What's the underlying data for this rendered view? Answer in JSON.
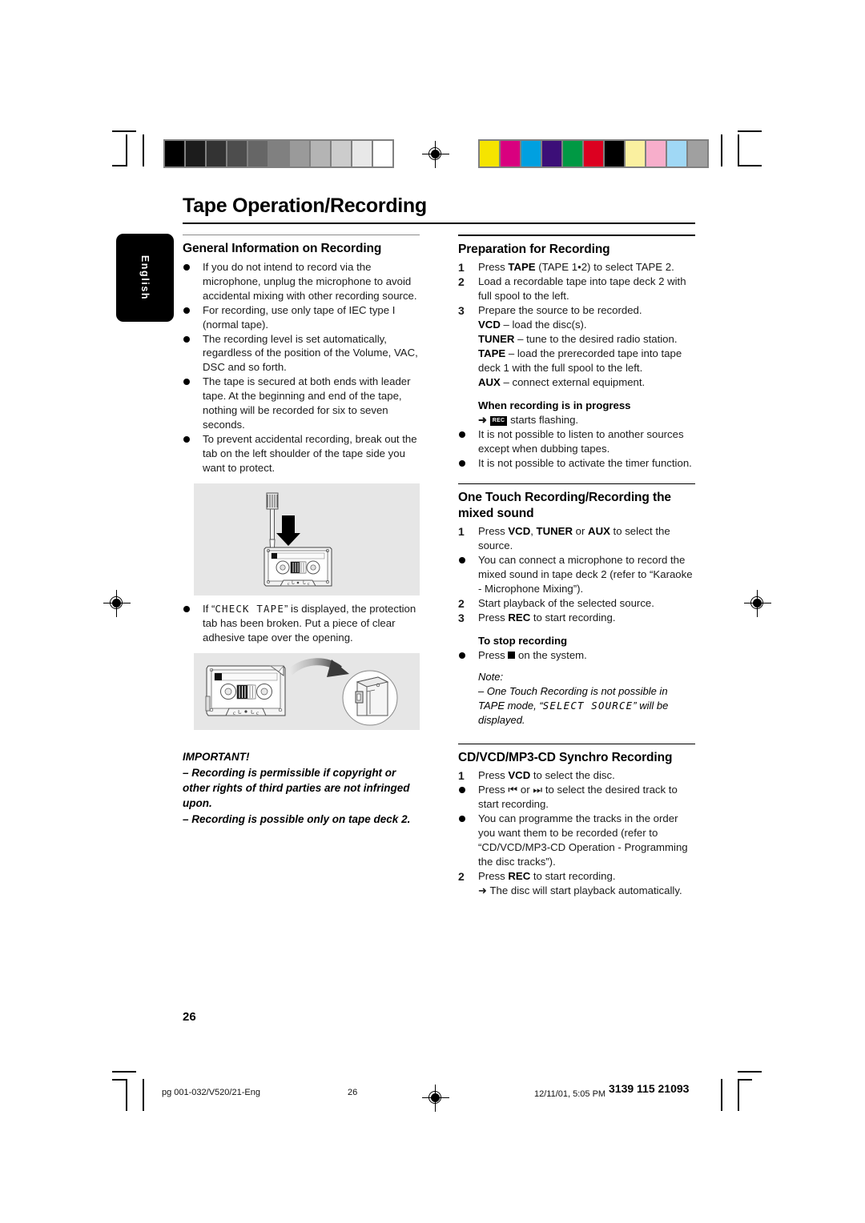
{
  "document": {
    "page_title": "Tape Operation/Recording",
    "page_number": "26",
    "language_tab": "English"
  },
  "calibration": {
    "grayscale_label": "grayscale-calibration-bar",
    "grayscale_swatches": [
      "#000000",
      "#1c1c1c",
      "#333333",
      "#4d4d4d",
      "#666666",
      "#808080",
      "#9a9a9a",
      "#b4b4b4",
      "#cccccc",
      "#e8e8e8",
      "#ffffff"
    ],
    "color_label": "color-calibration-bar",
    "color_swatches": [
      "#f5e400",
      "#d9007f",
      "#00a0e0",
      "#3c0f78",
      "#009944",
      "#dc0020",
      "#000000",
      "#faf0a0",
      "#f7aecb",
      "#a0d8f5",
      "#a0a0a0"
    ]
  },
  "left_column": {
    "section1": {
      "title": "General Information on Recording",
      "bullets": [
        "If you do not intend to record via the microphone, unplug the microphone to avoid accidental mixing with other recording source.",
        "For recording, use only tape of IEC type I (normal tape).",
        "The recording level is set automatically, regardless of the position of the Volume, VAC, DSC and so forth.",
        "The tape is secured at both ends with leader tape.  At the beginning and end of the tape, nothing will be recorded for six to seven seconds.",
        "To prevent accidental recording, break out the tab on the left shoulder of the tape side you want to protect."
      ],
      "figure1_name": "cassette-screwdriver-break-tab-illustration",
      "bullet_after_fig_pre": "If “",
      "bullet_after_fig_lcd": "CHECK TAPE",
      "bullet_after_fig_post": "” is displayed, the protection tab has been broken.  Put a piece of clear adhesive tape over the opening.",
      "figure2_name": "cassette-adhesive-tape-over-opening-illustration"
    },
    "important": {
      "heading": "IMPORTANT!",
      "lines": [
        "–  Recording is permissible if copyright or other rights of third parties are not infringed upon.",
        "–  Recording is possible only on tape deck 2."
      ]
    }
  },
  "right_column": {
    "section2": {
      "title": "Preparation for Recording",
      "steps": [
        {
          "num": "1",
          "pre": "Press ",
          "bold": "TAPE",
          "post": " (TAPE 1•2) to select TAPE 2."
        },
        {
          "num": "2",
          "pre": "",
          "bold": "",
          "post": "Load a recordable tape into tape deck 2 with full spool to the left."
        },
        {
          "num": "3",
          "pre": "",
          "bold": "",
          "post": "Prepare the source to be recorded."
        }
      ],
      "sources": [
        {
          "bold": "VCD",
          "text": " – load the disc(s)."
        },
        {
          "bold": "TUNER",
          "text": " – tune to the desired radio station."
        },
        {
          "bold": "TAPE",
          "text": " – load the prerecorded tape into tape deck 1 with the full spool to the left."
        },
        {
          "bold": "AUX",
          "text": " – connect external equipment."
        }
      ],
      "progress_heading": "When recording is in progress",
      "progress_arrow_pre": "➜ ",
      "progress_chip": "REC",
      "progress_arrow_post": " starts flashing.",
      "progress_bullets": [
        "It is not possible to listen to another sources except when dubbing tapes.",
        "It is not possible to activate the timer function."
      ]
    },
    "section3": {
      "title": "One Touch Recording/Recording the mixed sound",
      "step1_num": "1",
      "step1_pre": "Press ",
      "step1_b1": "VCD",
      "step1_mid1": ", ",
      "step1_b2": "TUNER",
      "step1_mid2": " or ",
      "step1_b3": "AUX",
      "step1_post": " to select the source.",
      "bullet1": "You can connect a microphone to record the mixed sound in tape deck 2 (refer to “Karaoke - Microphone Mixing”).",
      "step2_num": "2",
      "step2_text": "Start playback of the selected source.",
      "step3_num": "3",
      "step3_pre": "Press ",
      "step3_bold": "REC",
      "step3_post": " to start recording.",
      "stop_heading": "To stop recording",
      "stop_pre": "Press ",
      "stop_post": " on the system.",
      "note_label": "Note:",
      "note_pre": "–  One Touch Recording is not possible in TAPE mode, “",
      "note_lcd": "SELECT SOURCE",
      "note_post": "” will be displayed."
    },
    "section4": {
      "title": "CD/VCD/MP3-CD Synchro Recording",
      "step1_num": "1",
      "step1_pre": "Press ",
      "step1_bold": "VCD",
      "step1_post": " to select the disc.",
      "bullet1_pre": "Press ",
      "bullet1_prev_icon": "⏮",
      "bullet1_mid": " or ",
      "bullet1_next_icon": "⏭",
      "bullet1_post": " to select the desired track to start recording.",
      "bullet2": "You can programme the tracks in the order you want them to be recorded (refer to “CD/VCD/MP3-CD Operation - Programming the disc tracks”).",
      "step2_num": "2",
      "step2_pre": "Press ",
      "step2_bold": "REC",
      "step2_post": " to start recording.",
      "arrow_line": "➜ The disc will start playback automatically."
    }
  },
  "footer": {
    "file_ref": "pg 001-032/V520/21-Eng",
    "page": "26",
    "timestamp": "12/11/01, 5:05 PM",
    "code": "3139 115 21093"
  }
}
